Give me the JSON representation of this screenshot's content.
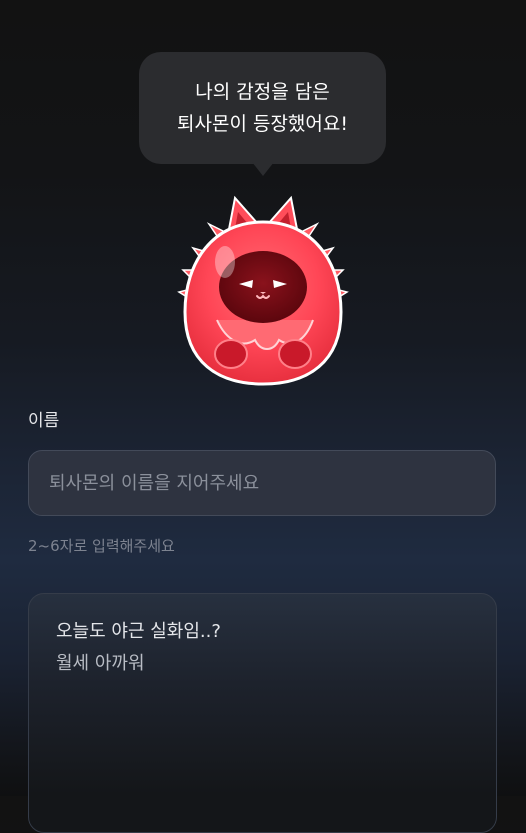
{
  "speech_bubble": {
    "line1": "나의 감정을 담은",
    "line2": "퇴사몬이 등장했어요!"
  },
  "character": {
    "icon": "red-fluffy-cat-monster",
    "body_color": "#ff4d58",
    "face_color": "#7a0d14"
  },
  "name_field": {
    "label": "이름",
    "value": "",
    "placeholder": "퇴사몬의 이름을 지어주세요",
    "helper": "2~6자로 입력해주세요"
  },
  "memo_card": {
    "line1": "오늘도 야근 실화임..?",
    "line2": "월세 아까워"
  }
}
